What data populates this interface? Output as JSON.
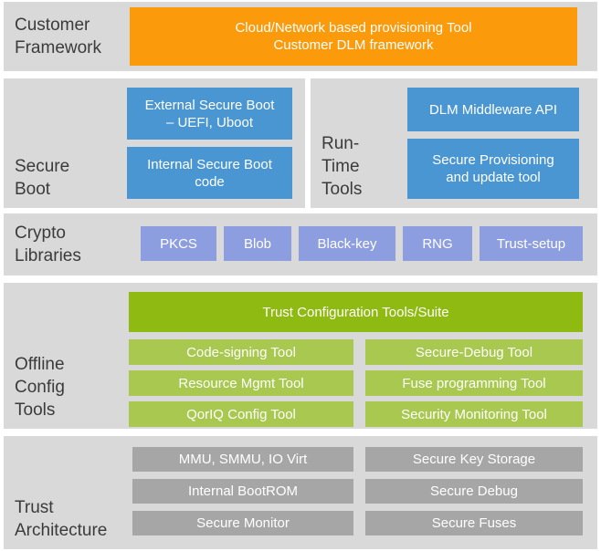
{
  "bands": [
    {
      "id": "customer",
      "label": [
        "Customer",
        "Framework"
      ],
      "color": "#fb9a0a",
      "boxes": [
        {
          "lines": [
            "Cloud/Network based provisioning Tool",
            "Customer  DLM framework"
          ]
        }
      ]
    },
    {
      "id": "secureboot",
      "label": [
        "Secure",
        "Boot"
      ],
      "color": "#4a96d2",
      "boxes": [
        {
          "lines": [
            "External  Secure  Boot",
            "– UEFI, Uboot"
          ]
        },
        {
          "lines": [
            "Internal  Secure  Boot",
            "code"
          ]
        }
      ]
    },
    {
      "id": "runtime",
      "label": [
        "Run-",
        "Time",
        "Tools"
      ],
      "color": "#4a96d2",
      "boxes": [
        {
          "lines": [
            "DLM Middleware API"
          ]
        },
        {
          "lines": [
            "Secure Provisioning",
            "and update tool"
          ]
        }
      ]
    },
    {
      "id": "crypto",
      "label": [
        "Crypto",
        "Libraries"
      ],
      "color": "#8d9ee0",
      "boxes": [
        {
          "lines": [
            "PKCS"
          ]
        },
        {
          "lines": [
            "Blob"
          ]
        },
        {
          "lines": [
            "Black-key"
          ]
        },
        {
          "lines": [
            "RNG"
          ]
        },
        {
          "lines": [
            "Trust-setup"
          ]
        }
      ]
    },
    {
      "id": "offline",
      "label": [
        "Offline",
        "Config",
        "Tools"
      ],
      "color": "#8fba12",
      "header": {
        "lines": [
          "Trust  Configuration  Tools/Suite"
        ]
      },
      "left_column": [
        {
          "lines": [
            "Code-signing  Tool"
          ]
        },
        {
          "lines": [
            "Resource  Mgmt  Tool"
          ]
        },
        {
          "lines": [
            "QorIQ Config Tool"
          ]
        }
      ],
      "right_column": [
        {
          "lines": [
            "Secure-Debug  Tool"
          ]
        },
        {
          "lines": [
            "Fuse programming  Tool"
          ]
        },
        {
          "lines": [
            "Security Monitoring  Tool"
          ]
        }
      ]
    },
    {
      "id": "trust",
      "label": [
        "Trust",
        "Architecture"
      ],
      "color": "#a6a6a6",
      "left_column": [
        {
          "lines": [
            "MMU,  SMMU,  IO Virt"
          ]
        },
        {
          "lines": [
            "Internal  BootROM"
          ]
        },
        {
          "lines": [
            "Secure Monitor"
          ]
        }
      ],
      "right_column": [
        {
          "lines": [
            "Secure Key Storage"
          ]
        },
        {
          "lines": [
            "Secure Debug"
          ]
        },
        {
          "lines": [
            "Secure Fuses"
          ]
        }
      ]
    }
  ],
  "palette": {
    "band_background": "#d9d9d9",
    "page_background": "#ffffff",
    "label_text": "#3b3b3b",
    "box_text": "#ffffff",
    "orange": "#fb9a0a",
    "blue": "#4a96d2",
    "violet": "#8d9ee0",
    "green_dark": "#8fba12",
    "green_light": "#a8c84f",
    "gray": "#a6a6a6"
  }
}
